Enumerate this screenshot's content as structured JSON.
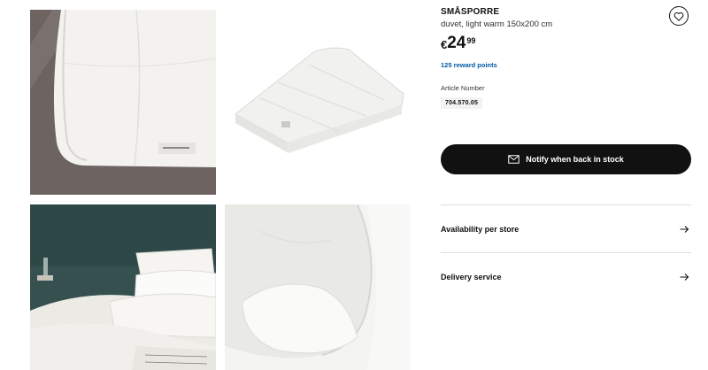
{
  "product": {
    "brand": "SMÅSPORRE",
    "description": "duvet, light warm 150x200 cm",
    "price": {
      "currency": "€",
      "integer": "24",
      "decimal": "99"
    },
    "reward": "125 reward points",
    "article_label": "Article Number",
    "article_number": "704.570.05"
  },
  "actions": {
    "notify_label": "Notify when back in stock",
    "availability_label": "Availability per store",
    "delivery_label": "Delivery service"
  },
  "icons": {
    "favorite": "heart-icon",
    "notify": "envelope-icon",
    "availability": "arrow-right-icon",
    "delivery": "arrow-right-icon"
  },
  "colors": {
    "reward_text": "#0058a3",
    "button_bg": "#111111",
    "button_text": "#ffffff"
  }
}
